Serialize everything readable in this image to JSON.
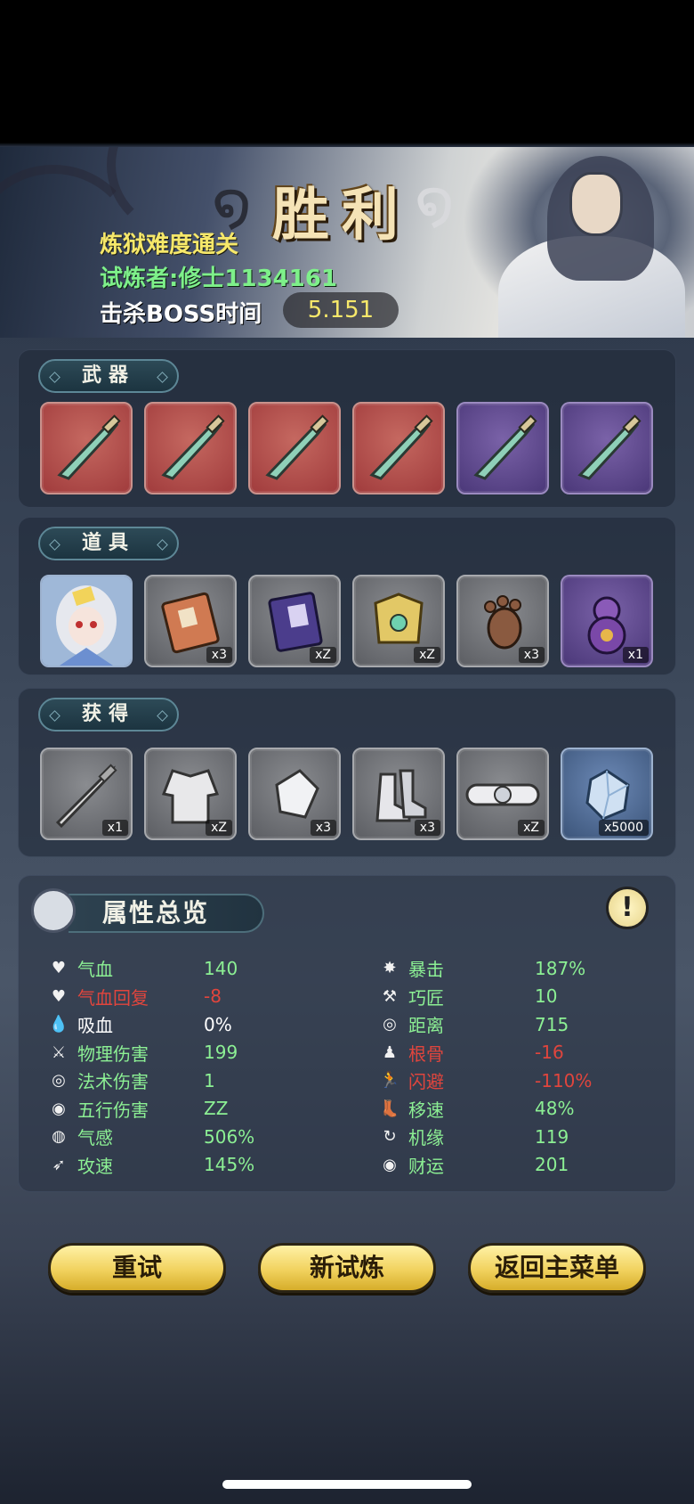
{
  "banner": {
    "title": "胜利",
    "difficulty": "炼狱难度通关",
    "challenger": "试炼者:修士1134161",
    "boss_label": "击杀BOSS时间",
    "boss_time": "5.151"
  },
  "weapons": {
    "label": "武器",
    "items": [
      {
        "rarity": "red",
        "icon": "saber-icon"
      },
      {
        "rarity": "red",
        "icon": "saber-icon"
      },
      {
        "rarity": "red",
        "icon": "saber-icon"
      },
      {
        "rarity": "red",
        "icon": "saber-icon"
      },
      {
        "rarity": "purple",
        "icon": "saber-icon"
      },
      {
        "rarity": "purple",
        "icon": "saber-icon"
      }
    ]
  },
  "props": {
    "label": "道具",
    "items": [
      {
        "rarity": "blue",
        "icon": "character-portrait-icon",
        "count": ""
      },
      {
        "rarity": "gray",
        "icon": "book-icon",
        "count": "x3"
      },
      {
        "rarity": "gray",
        "icon": "demon-book-icon",
        "count": "xZ"
      },
      {
        "rarity": "gray",
        "icon": "golden-armor-icon",
        "count": "xZ"
      },
      {
        "rarity": "gray",
        "icon": "paw-icon",
        "count": "x3"
      },
      {
        "rarity": "purple",
        "icon": "gourd-icon",
        "count": "x1"
      }
    ]
  },
  "gains": {
    "label": "获得",
    "items": [
      {
        "rarity": "gray",
        "icon": "sword-icon",
        "count": "x1"
      },
      {
        "rarity": "gray",
        "icon": "robe-icon",
        "count": "xZ"
      },
      {
        "rarity": "gray",
        "icon": "gem-fragment-icon",
        "count": "x3"
      },
      {
        "rarity": "gray",
        "icon": "boots-icon",
        "count": "x3"
      },
      {
        "rarity": "gray",
        "icon": "belt-icon",
        "count": "xZ"
      },
      {
        "rarity": "blue",
        "icon": "crystal-icon",
        "count": "x5000"
      }
    ]
  },
  "attributes": {
    "title": "属性总览",
    "left": [
      {
        "name": "气血",
        "value": "140",
        "icon": "♥",
        "name_color": "green",
        "value_color": "green"
      },
      {
        "name": "气血回复",
        "value": "-8",
        "icon": "♥",
        "name_color": "red",
        "value_color": "red"
      },
      {
        "name": "吸血",
        "value": "0%",
        "icon": "💧",
        "name_color": "white",
        "value_color": "white"
      },
      {
        "name": "物理伤害",
        "value": "199",
        "icon": "⚔",
        "name_color": "green",
        "value_color": "green"
      },
      {
        "name": "法术伤害",
        "value": "1",
        "icon": "◎",
        "name_color": "green",
        "value_color": "green"
      },
      {
        "name": "五行伤害",
        "value": "ZZ",
        "icon": "◉",
        "name_color": "green",
        "value_color": "green"
      },
      {
        "name": "气感",
        "value": "506%",
        "icon": "◍",
        "name_color": "green",
        "value_color": "green"
      },
      {
        "name": "攻速",
        "value": "145%",
        "icon": "➶",
        "name_color": "green",
        "value_color": "green"
      }
    ],
    "right": [
      {
        "name": "暴击",
        "value": "187%",
        "icon": "✸",
        "name_color": "green",
        "value_color": "green"
      },
      {
        "name": "巧匠",
        "value": "10",
        "icon": "⚒",
        "name_color": "green",
        "value_color": "green"
      },
      {
        "name": "距离",
        "value": "715",
        "icon": "◎",
        "name_color": "green",
        "value_color": "green"
      },
      {
        "name": "根骨",
        "value": "-16",
        "icon": "♟",
        "name_color": "red",
        "value_color": "red"
      },
      {
        "name": "闪避",
        "value": "-110%",
        "icon": "🏃",
        "name_color": "red",
        "value_color": "red"
      },
      {
        "name": "移速",
        "value": "48%",
        "icon": "👢",
        "name_color": "green",
        "value_color": "green"
      },
      {
        "name": "机缘",
        "value": "119",
        "icon": "↻",
        "name_color": "green",
        "value_color": "green"
      },
      {
        "name": "财运",
        "value": "201",
        "icon": "◉",
        "name_color": "green",
        "value_color": "green"
      }
    ]
  },
  "buttons": {
    "retry": "重试",
    "new_trial": "新试炼",
    "main_menu": "返回主菜单"
  }
}
